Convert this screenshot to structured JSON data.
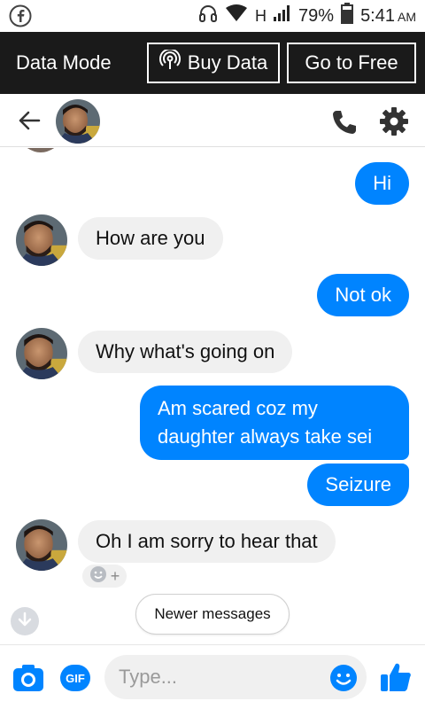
{
  "status_bar": {
    "network": "H",
    "battery": "79%",
    "time": "5:41",
    "ampm": "AM"
  },
  "data_bar": {
    "mode_label": "Data Mode",
    "buy_label": "Buy Data",
    "free_label": "Go to Free"
  },
  "messages": [
    {
      "direction": "out",
      "text": "Hi"
    },
    {
      "direction": "in",
      "text": "How are you"
    },
    {
      "direction": "out",
      "text": "Not ok"
    },
    {
      "direction": "in",
      "text": "Why what's going on"
    },
    {
      "direction": "out",
      "text": "Am scared coz my daughter always take sei"
    },
    {
      "direction": "out",
      "text": "Seizure"
    },
    {
      "direction": "in",
      "text": "Oh I am sorry to hear that"
    }
  ],
  "reaction": {
    "plus": "+"
  },
  "newer_messages": "Newer messages",
  "composer": {
    "gif_label": "GIF",
    "placeholder": "Type..."
  },
  "colors": {
    "accent": "#0084ff",
    "incoming_bubble": "#f0f0f0",
    "top_bar": "#1a1a1a"
  }
}
